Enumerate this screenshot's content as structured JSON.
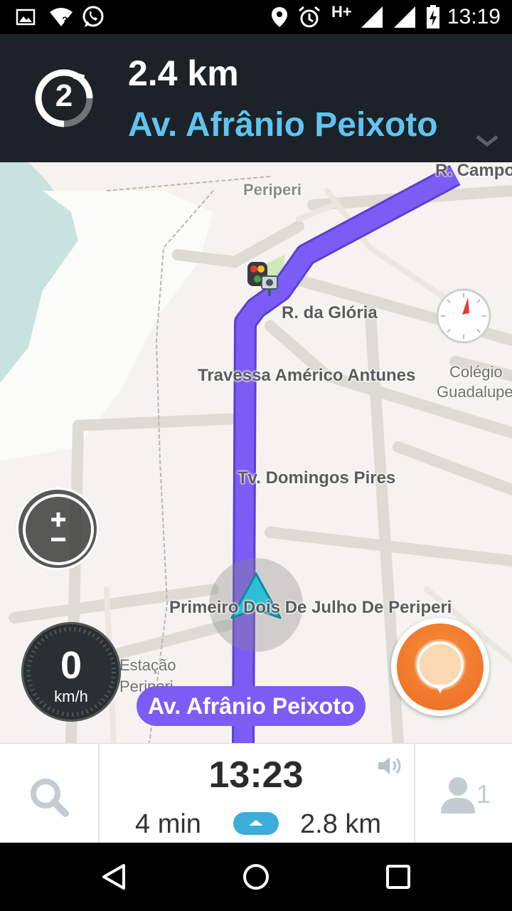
{
  "status_bar": {
    "network": "H+",
    "time": "13:19"
  },
  "instruction": {
    "exit_number": "2",
    "distance": "2.4 km",
    "street": "Av. Afrânio Peixoto"
  },
  "map": {
    "labels": {
      "r_campos": "R. Campos",
      "periperi": "Periperi",
      "r_gloria": "R. da Glória",
      "travessa_americo": "Travessa Américo Antunes",
      "colegio_line1": "Colégio",
      "colegio_line2": "Guadalupe",
      "tv_domingos": "Tv. Domingos Pires",
      "primeiro": "Primeiro Dois De Julho De Periperi",
      "estacao_line1": "Estação",
      "estacao_line2": "Periperi"
    },
    "current_street": "Av. Afrânio Peixoto",
    "route_color": "#7b5cf5"
  },
  "speedometer": {
    "speed": "0",
    "unit": "km/h"
  },
  "eta": {
    "arrival_time": "13:23",
    "duration": "4 min",
    "distance": "2.8 km"
  },
  "passengers": {
    "count": "1"
  },
  "icons": {
    "search": "search-icon",
    "sound": "speaker-icon",
    "person": "person-icon",
    "report": "report-pin-icon",
    "zoom": "zoom-icon",
    "compass": "compass-icon"
  }
}
